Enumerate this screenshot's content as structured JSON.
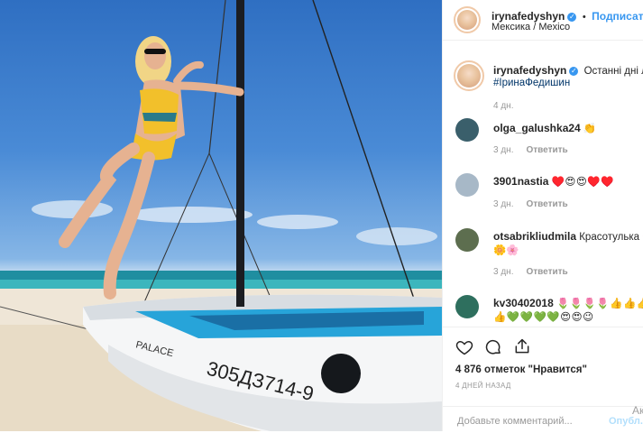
{
  "post": {
    "boat_text_brand": "PALACE",
    "boat_text_number": "305ДЗ714-9"
  },
  "header": {
    "username": "irynaфedyshyn",
    "username_display": "irynafedyshyn",
    "follow_label": "Подписаться",
    "location": "Мексика / Mexico",
    "separator": "•"
  },
  "caption": {
    "username": "irynafedyshyn",
    "text": "Останні дні літ",
    "hashtag": "#ІринаФедишин",
    "age": "4 дн."
  },
  "comments": [
    {
      "username": "olga_galushka24",
      "text": "👏",
      "age": "3 дн.",
      "reply": "Ответить",
      "avatar_color": "#3a5f6b"
    },
    {
      "username": "3901nastia",
      "text": "♥️😍😍♥️♥️",
      "age": "3 дн.",
      "reply": "Ответить",
      "avatar_color": "#a7b8c7"
    },
    {
      "username": "otsabrikliudmila",
      "text": "Красотулька 🌸",
      "text_line2": "🌼🌸",
      "age": "3 дн.",
      "reply": "Ответить",
      "avatar_color": "#5d6e4f"
    },
    {
      "username": "kv30402018",
      "text": "🌷🌷🌷🌷👍👍👍",
      "text_line2": "👍💚💚💚💚😍😍😉",
      "age": "",
      "reply": "",
      "avatar_color": "#2e6f5e"
    }
  ],
  "actions": {
    "likes": "4 876 отметок \"Нравится\"",
    "time": "4 ДНЕЙ НАЗАД",
    "comment_placeholder": "Добавьте комментарий...",
    "publish_label": "Опубл...",
    "watermark": "Акт"
  },
  "colors": {
    "accent": "#3897f0",
    "muted": "#999999",
    "text": "#262626"
  }
}
